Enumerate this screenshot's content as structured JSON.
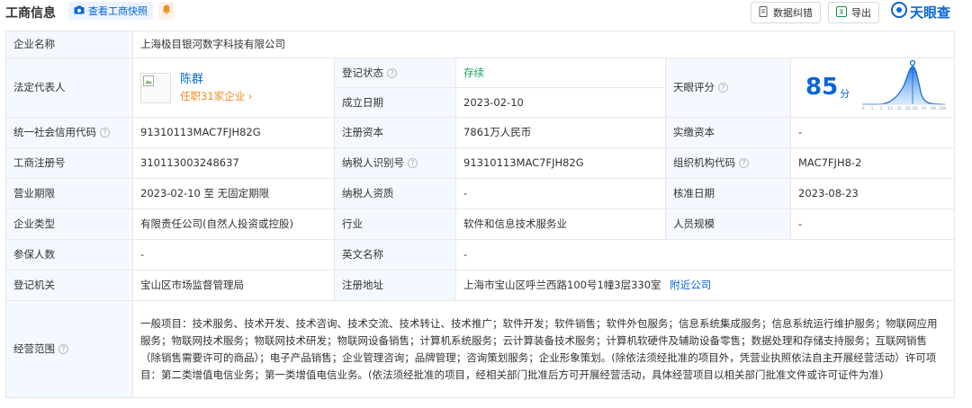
{
  "header": {
    "title": "工商信息",
    "snapshot_label": "查看工商快照",
    "correct_label": "数据纠错",
    "export_label": "导出",
    "logo_text": "天眼查"
  },
  "company_name": {
    "label": "企业名称",
    "value": "上海极目银河数字科技有限公司"
  },
  "legal_rep": {
    "label": "法定代表人",
    "name": "陈群",
    "sub": "任职31家企业"
  },
  "reg_status": {
    "label": "登记状态",
    "value": "存续"
  },
  "est_date": {
    "label": "成立日期",
    "value": "2023-02-10"
  },
  "score": {
    "label": "天眼评分",
    "value": "85",
    "unit": "分",
    "ticks": [
      "0",
      "1",
      "3",
      "15",
      "35",
      "65",
      "85",
      "97",
      "99",
      "100"
    ]
  },
  "credit_code": {
    "label": "统一社会信用代码",
    "value": "91310113MAC7FJH82G"
  },
  "reg_capital": {
    "label": "注册资本",
    "value": "7861万人民币"
  },
  "paid_capital": {
    "label": "实缴资本",
    "value": "-"
  },
  "reg_no": {
    "label": "工商注册号",
    "value": "310113003248637"
  },
  "taxpayer_id": {
    "label": "纳税人识别号",
    "value": "91310113MAC7FJH82G"
  },
  "org_code": {
    "label": "组织机构代码",
    "value": "MAC7FJH8-2"
  },
  "term": {
    "label": "营业期限",
    "value": "2023-02-10 至 无固定期限"
  },
  "taxpayer_qual": {
    "label": "纳税人资质",
    "value": "-"
  },
  "approve_date": {
    "label": "核准日期",
    "value": "2023-08-23"
  },
  "company_type": {
    "label": "企业类型",
    "value": "有限责任公司(自然人投资或控股)"
  },
  "industry": {
    "label": "行业",
    "value": "软件和信息技术服务业"
  },
  "staff_size": {
    "label": "人员规模",
    "value": "-"
  },
  "insured": {
    "label": "参保人数",
    "value": "-"
  },
  "en_name": {
    "label": "英文名称",
    "value": "-"
  },
  "authority": {
    "label": "登记机关",
    "value": "宝山区市场监督管理局"
  },
  "address": {
    "label": "注册地址",
    "value": "上海市宝山区呼兰西路100号1幢3层330室",
    "link": "附近公司"
  },
  "scope": {
    "label": "经营范围",
    "value": "一般项目：技术服务、技术开发、技术咨询、技术交流、技术转让、技术推广；软件开发；软件销售；软件外包服务；信息系统集成服务；信息系统运行维护服务；物联网应用服务；物联网技术服务；物联网技术研发；物联网设备销售；计算机系统服务；云计算装备技术服务；计算机软硬件及辅助设备零售；数据处理和存储支持服务；互联网销售（除销售需要许可的商品）；电子产品销售；企业管理咨询；品牌管理；咨询策划服务；企业形象策划。(除依法须经批准的项目外，凭营业执照依法自主开展经营活动）许可项目：第二类增值电信业务；第一类增值电信业务。(依法须经批准的项目，经相关部门批准后方可开展经营活动，具体经营项目以相关部门批准文件或许可证件为准)"
  }
}
